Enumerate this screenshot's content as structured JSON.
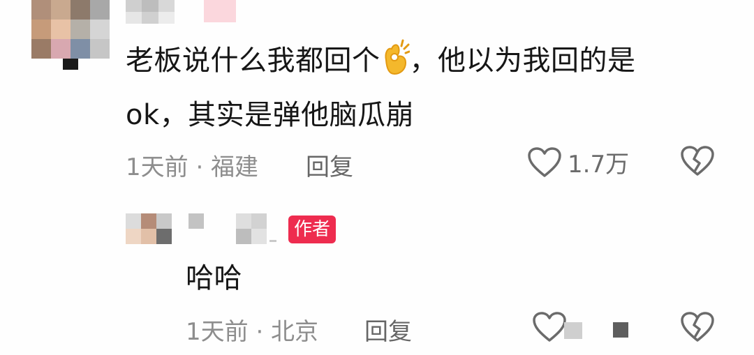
{
  "comment": {
    "line1_before_emoji": "老板说什么我都回个",
    "emoji_name": "ok-hand-icon",
    "line1_after_emoji": "，他以为我回的是",
    "line2": "ok，其实是弹他脑瓜崩",
    "time_location": "1天前 · 福建",
    "reply_label": "回复",
    "like_count": "1.7万"
  },
  "reply": {
    "badge": "作者",
    "text": "哈哈",
    "time_location": "1天前 · 北京",
    "reply_label": "回复"
  },
  "colors": {
    "badge": "#ee2c4f",
    "text": "#161616",
    "meta": "#8d8d8d"
  }
}
